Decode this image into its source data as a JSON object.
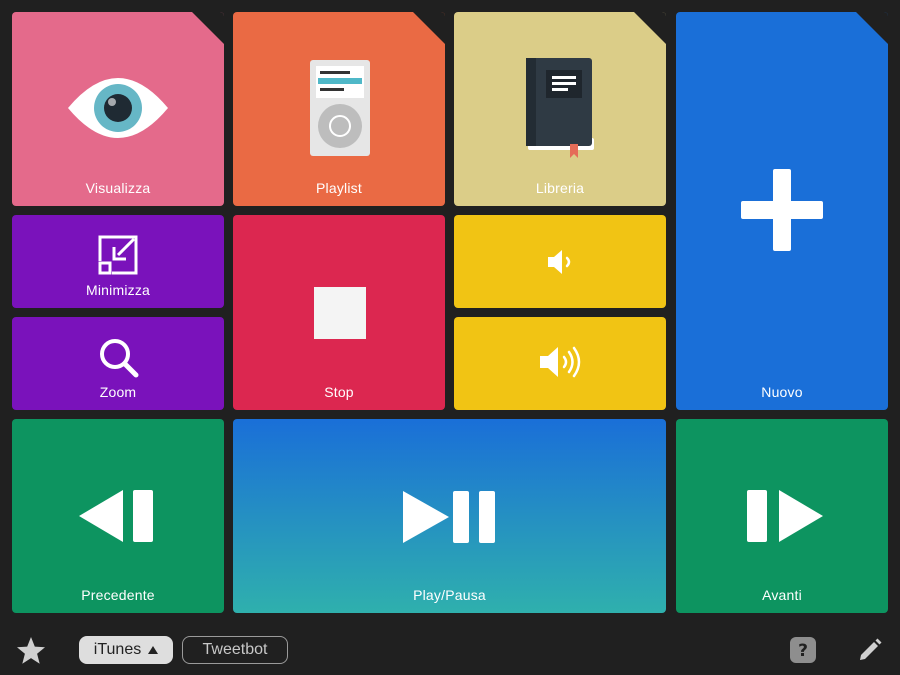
{
  "tiles": {
    "visualizza": {
      "label": "Visualizza",
      "color": "#e46a8b"
    },
    "playlist": {
      "label": "Playlist",
      "color": "#ea6a44"
    },
    "libreria": {
      "label": "Libreria",
      "color": "#dbcd88"
    },
    "nuovo": {
      "label": "Nuovo",
      "color": "#1a6fd8"
    },
    "minimizza": {
      "label": "Minimizza",
      "color": "#7a12bb"
    },
    "zoom": {
      "label": "Zoom",
      "color": "#7a12bb"
    },
    "stop": {
      "label": "Stop",
      "color": "#dc2750"
    },
    "volume_down": {
      "label": "",
      "color": "#f1c414"
    },
    "volume_up": {
      "label": "",
      "color": "#f1c414"
    },
    "precedente": {
      "label": "Precedente",
      "color": "#0d9460"
    },
    "play_pausa": {
      "label": "Play/Pausa",
      "color_top": "#1a6fd8",
      "color_bottom": "#2fb0ad"
    },
    "avanti": {
      "label": "Avanti",
      "color": "#0d9460"
    }
  },
  "bottom_bar": {
    "favorites_icon": "star-icon",
    "tabs": [
      {
        "label": "iTunes",
        "active": true,
        "indicator": "triangle-up-icon"
      },
      {
        "label": "Tweetbot",
        "active": false
      }
    ],
    "help_icon": "question-icon",
    "edit_icon": "pencil-icon"
  }
}
